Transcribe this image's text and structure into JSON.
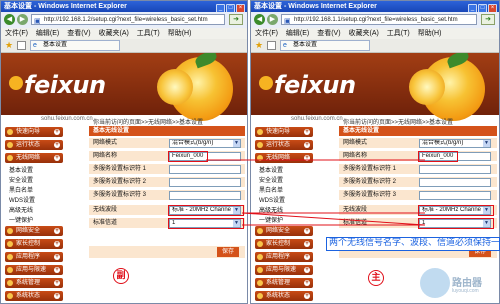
{
  "left": {
    "title": "基本设置 - Windows Internet Explorer",
    "url": "http://192.168.1.2/setup.cgi?next_file=wireless_basic_set.htm",
    "tab": "基本设置"
  },
  "right": {
    "title": "基本设置 - Windows Internet Explorer",
    "url": "http://192.168.1.1/setup.cgi?next_file=wireless_basic_set.htm",
    "tab": "基本设置",
    "menubar": [
      "文件(F)",
      "编辑(E)",
      "查看(V)",
      "收藏夹(A)",
      "工具(T)",
      "帮助(H)"
    ]
  },
  "site": {
    "logo": "feixun",
    "url": "sohu.feixun.com.cn",
    "breadcrumb": "你当前访问的页面>>无线网络>>基本设置"
  },
  "sidebar": [
    {
      "label": "快速向导",
      "type": "main"
    },
    {
      "label": "运行状态",
      "type": "main"
    },
    {
      "label": "无线网络",
      "type": "main"
    },
    {
      "label": "基本设置",
      "type": "sub"
    },
    {
      "label": "安全设置",
      "type": "sub"
    },
    {
      "label": "黑白名单",
      "type": "sub"
    },
    {
      "label": "WDS设置",
      "type": "sub"
    },
    {
      "label": "高级无线",
      "type": "sub"
    },
    {
      "label": "一键保护",
      "type": "sub"
    },
    {
      "label": "网络安全",
      "type": "main"
    },
    {
      "label": "家长控制",
      "type": "main"
    },
    {
      "label": "应用程序",
      "type": "main"
    },
    {
      "label": "应用与限速",
      "type": "main"
    },
    {
      "label": "系统管理",
      "type": "main"
    },
    {
      "label": "系统状态",
      "type": "main"
    }
  ],
  "panel": {
    "header": "基本无线设置",
    "rows": [
      {
        "label": "网络模式",
        "value": "混合模式(b/g/n)",
        "dropdown": true
      },
      {
        "label": "网络名称",
        "value": "Feixun_000",
        "dropdown": false
      },
      {
        "label": "多服务设置标识符 1",
        "value": "",
        "dropdown": false
      },
      {
        "label": "多服务设置标识符 2",
        "value": "",
        "dropdown": false
      },
      {
        "label": "多服务设置标识符 3",
        "value": "",
        "dropdown": false
      },
      {
        "label": "无线波段",
        "value": "标准 - 20MHz Channe",
        "dropdown": true
      },
      {
        "label": "标准信道",
        "value": "1",
        "dropdown": true
      }
    ],
    "save": "保存"
  },
  "annotations": {
    "secondary": "副",
    "primary": "主",
    "note": "两个无线信号名字、波段、信道必须保持一致"
  },
  "watermark": {
    "text": "路由器",
    "sub": "luyouqi.com"
  },
  "colors": {
    "titlebar": "#1846b8",
    "brand": "#d4521a",
    "annotation_red": "#e0101a",
    "annotation_blue": "#1c63e0"
  }
}
